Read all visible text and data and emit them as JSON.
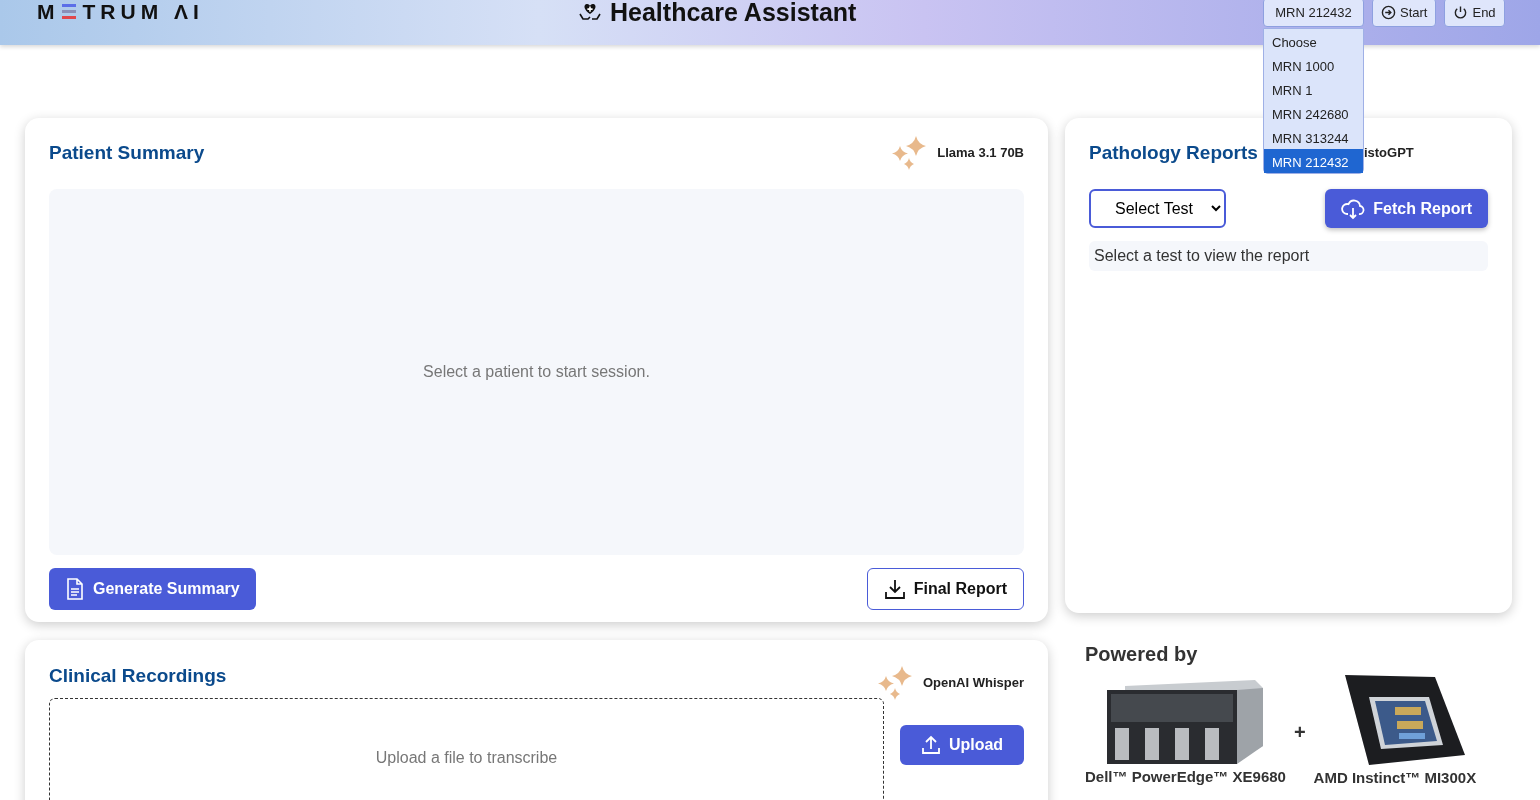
{
  "header": {
    "logo": {
      "prefix": "M",
      "suffix": "TRUM ΛI"
    },
    "title": "Healthcare Assistant",
    "patient_select": {
      "value": "MRN 212432",
      "expanded": true,
      "options": [
        {
          "label": "Choose",
          "selected": false
        },
        {
          "label": "MRN 1000",
          "selected": false
        },
        {
          "label": "MRN 1",
          "selected": false
        },
        {
          "label": "MRN 242680",
          "selected": false
        },
        {
          "label": "MRN 313244",
          "selected": false
        },
        {
          "label": "MRN 212432",
          "selected": true
        }
      ]
    },
    "buttons": [
      {
        "label": "Start",
        "kind": "start"
      },
      {
        "label": "End",
        "kind": "end"
      }
    ]
  },
  "patient_summary": {
    "title": "Patient Summary",
    "model": "Llama 3.1 70B",
    "message": "Select a patient to start session.",
    "buttons": [
      {
        "label": "Generate Summary",
        "kind": "primary"
      },
      {
        "label": "Final Report",
        "kind": "outline"
      }
    ]
  },
  "pathology_reports": {
    "title": "Pathology Reports",
    "model": "istoGPT",
    "test_select": {
      "value": "Select Test"
    },
    "fetch_button": "Fetch Report",
    "message": "Select a test to view the report"
  },
  "clinical_recordings": {
    "title": "Clinical Recordings",
    "model": "OpenAI Whisper",
    "dropzone": "Upload a file to transcribe",
    "upload_button": "Upload"
  },
  "powered_by": {
    "title": "Powered by",
    "separator": "+",
    "items": [
      {
        "label": "Dell™ PowerEdge™ XE9680",
        "kind": "server"
      },
      {
        "label": "AMD Instinct™ MI300X",
        "kind": "chip"
      }
    ]
  }
}
